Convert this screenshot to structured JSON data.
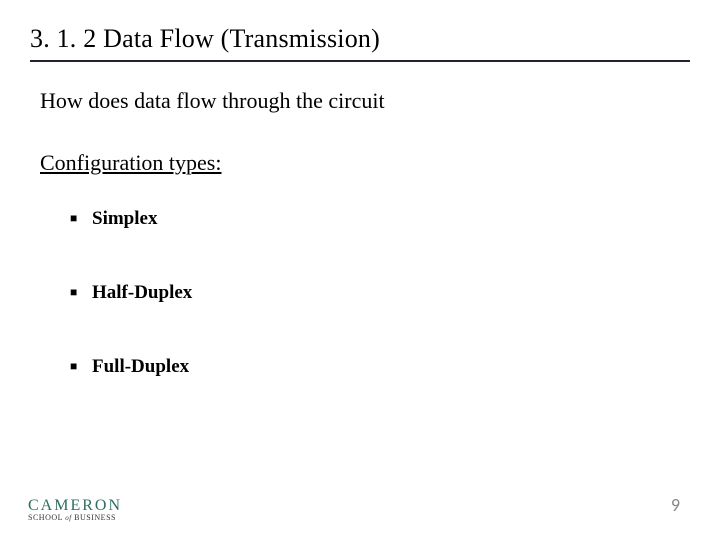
{
  "header": {
    "title": "3. 1. 2  Data Flow (Transmission)"
  },
  "body": {
    "intro": "How does data flow through the circuit",
    "subhead": "Configuration types:",
    "items": [
      "Simplex",
      "Half-Duplex",
      "Full-Duplex"
    ]
  },
  "footer": {
    "logo_main": "CAMERON",
    "logo_sub_pre": "SCHOOL",
    "logo_sub_of": "of",
    "logo_sub_post": "BUSINESS",
    "page_number": "9"
  }
}
